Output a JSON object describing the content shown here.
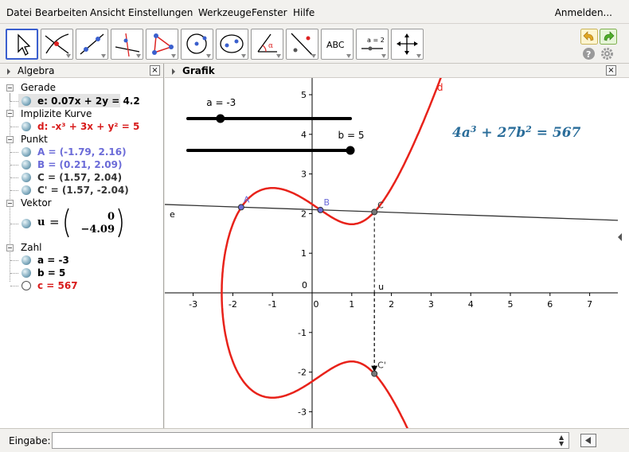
{
  "menu": {
    "items": [
      "Datei",
      "Bearbeiten",
      "Ansicht",
      "Einstellungen",
      "Werkzeuge",
      "Fenster",
      "Hilfe"
    ],
    "login": "Anmelden..."
  },
  "toolbar": {
    "tools": [
      {
        "icon": "move-pointer-icon",
        "active": true
      },
      {
        "icon": "point-intersect-icon"
      },
      {
        "icon": "line-through-two-points-icon"
      },
      {
        "icon": "perpendicular-line-icon"
      },
      {
        "icon": "polygon-icon"
      },
      {
        "icon": "circle-center-point-icon"
      },
      {
        "icon": "ellipse-icon"
      },
      {
        "icon": "angle-icon"
      },
      {
        "icon": "reflect-about-line-icon"
      },
      {
        "icon": "text-tool-icon",
        "label": "ABC"
      },
      {
        "icon": "slider-tool-icon",
        "label": "a = 2"
      },
      {
        "icon": "move-graphics-view-icon"
      }
    ],
    "right": [
      "undo-icon",
      "redo-icon",
      "help-icon",
      "settings-icon"
    ]
  },
  "algebra": {
    "title": "Algebra",
    "close": "×",
    "groups": [
      {
        "name": "Gerade",
        "items": [
          {
            "text": "e: 0.07x + 2y = 4.2",
            "color": "#000000",
            "selected": true
          }
        ]
      },
      {
        "name": "Implizite Kurve",
        "items": [
          {
            "text": "d: -x³ + 3x + y² = 5",
            "color": "#d81b1b"
          }
        ]
      },
      {
        "name": "Punkt",
        "items": [
          {
            "text": "A = (-1.79, 2.16)",
            "color": "#6b6bd8"
          },
          {
            "text": "B = (0.21, 2.09)",
            "color": "#6b6bd8"
          },
          {
            "text": "C = (1.57, 2.04)",
            "color": "#333333"
          },
          {
            "text": "C' = (1.57, -2.04)",
            "color": "#333333"
          }
        ]
      },
      {
        "name": "Vektor",
        "items": [
          {
            "name": "u",
            "x": "0",
            "y": "−4.09",
            "color": "#000000"
          }
        ]
      },
      {
        "name": "Zahl",
        "items": [
          {
            "text": "a = -3",
            "color": "#000000"
          },
          {
            "text": "b = 5",
            "color": "#000000"
          },
          {
            "text": "c = 567",
            "color": "#d81b1b",
            "hidden": true
          }
        ]
      }
    ]
  },
  "graphics": {
    "title": "Grafik",
    "close": "×",
    "x_ticks": [
      "-3",
      "-2",
      "-1",
      "0",
      "1",
      "2",
      "3",
      "4",
      "5",
      "6",
      "7"
    ],
    "y_ticks": [
      "5",
      "4",
      "3",
      "2",
      "1",
      "0",
      "-1",
      "-2",
      "-3"
    ],
    "axis_range": {
      "x": [
        -3.6,
        7.6
      ],
      "y": [
        -3.5,
        5.5
      ]
    },
    "curve_label": "d",
    "line_label": "e",
    "vector_label": "u",
    "point_labels": {
      "A": "A",
      "B": "B",
      "C": "C",
      "C_prime": "C'"
    },
    "points": {
      "A": [
        -1.79,
        2.16
      ],
      "B": [
        0.21,
        2.09
      ],
      "C": [
        1.57,
        2.04
      ],
      "C_prime": [
        1.57,
        -2.04
      ]
    },
    "line": {
      "a": 0.07,
      "b": 2,
      "c": 4.2
    },
    "curve": {
      "equation": "-x³ + 3x + y² = 5"
    },
    "sliders": [
      {
        "label": "a = -3",
        "min": -5,
        "max": 5,
        "value": -3
      },
      {
        "label": "b = 5",
        "min": -5,
        "max": 5,
        "value": 5
      }
    ],
    "formula": {
      "base1": "4a",
      "exp1": "3",
      "mid": " + 27b",
      "exp2": "2",
      "end": " = 567"
    },
    "colors": {
      "curve": "#e8221a",
      "points": "#6b6bd8",
      "formula": "#2a6d9a",
      "line": "#333333"
    }
  },
  "input": {
    "label": "Eingabe:",
    "value": "",
    "placeholder": ""
  }
}
